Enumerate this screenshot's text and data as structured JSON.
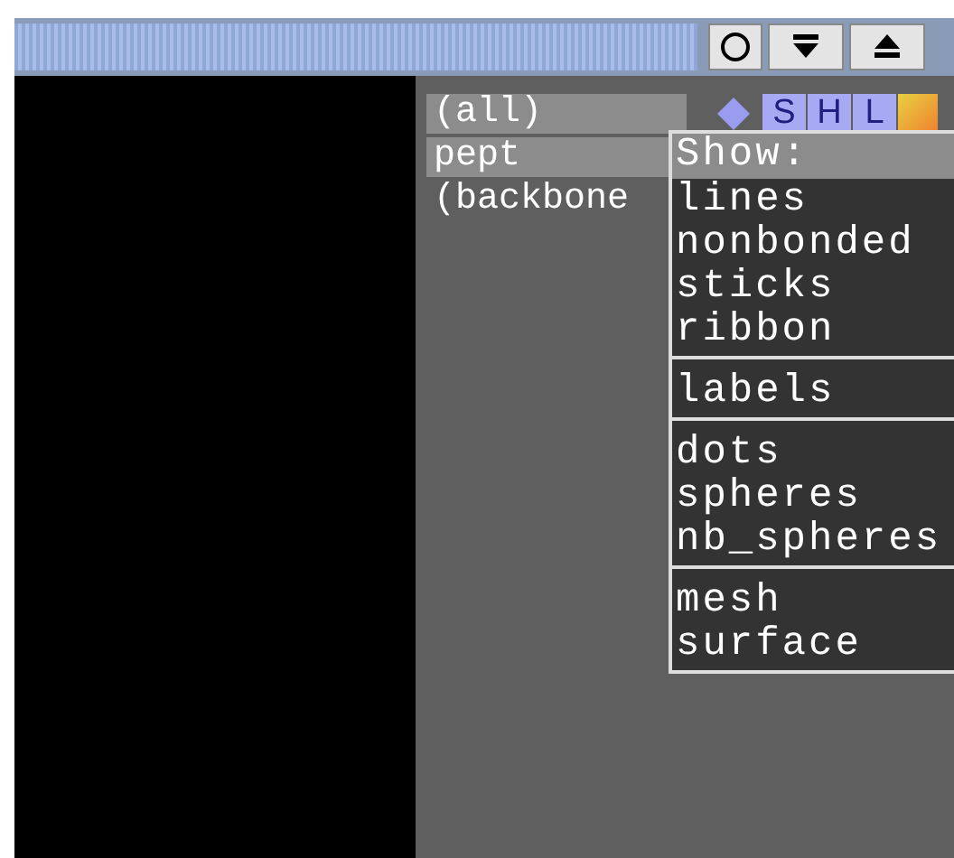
{
  "object_list": [
    {
      "name": "(all)",
      "enabled": true
    },
    {
      "name": "pept",
      "enabled": true
    },
    {
      "name": "(backbone",
      "enabled": false
    }
  ],
  "action_buttons": [
    "S",
    "H",
    "L"
  ],
  "show_menu": {
    "title": "Show:",
    "sections": [
      [
        "lines",
        "nonbonded",
        "sticks",
        "ribbon"
      ],
      [
        "labels"
      ],
      [
        "dots",
        "spheres",
        "nb_spheres"
      ],
      [
        "mesh",
        "surface"
      ]
    ]
  }
}
